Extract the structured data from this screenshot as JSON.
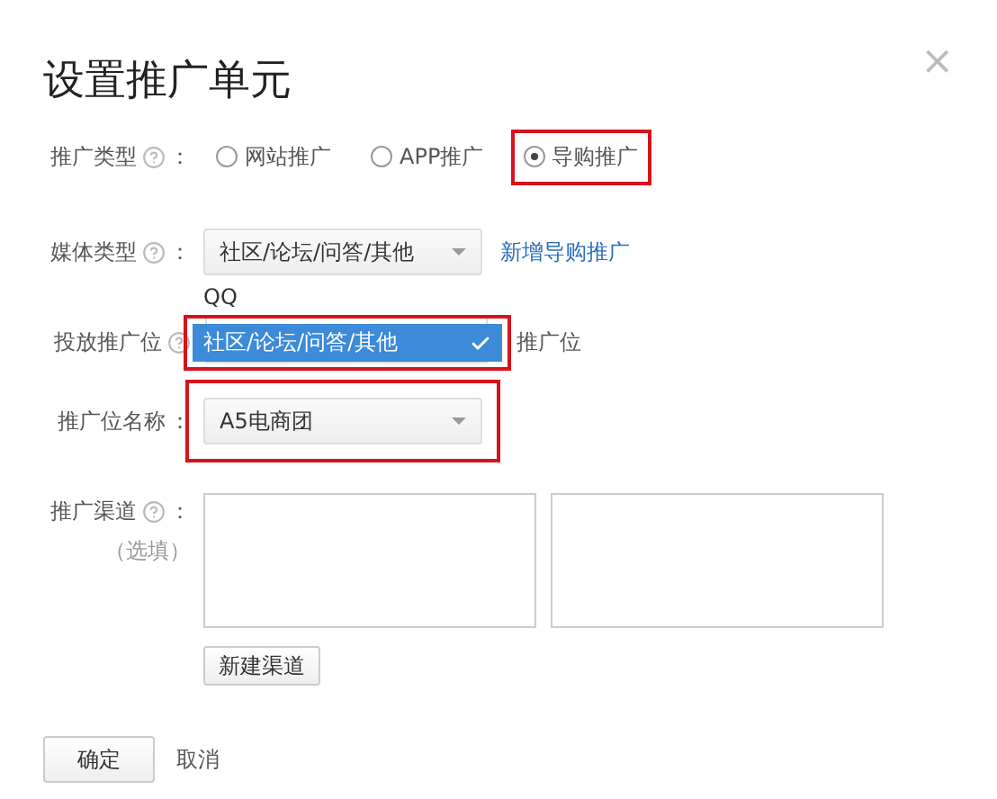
{
  "dialog": {
    "title": "设置推广单元",
    "close": "×"
  },
  "promo_type": {
    "label": "推广类型",
    "help": true,
    "colon": "：",
    "options": [
      {
        "label": "网站推广",
        "selected": false,
        "highlighted": false
      },
      {
        "label": "APP推广",
        "selected": false,
        "highlighted": false
      },
      {
        "label": "导购推广",
        "selected": true,
        "highlighted": true
      }
    ]
  },
  "media_type": {
    "label": "媒体类型",
    "help": true,
    "colon": "：",
    "value": "社区/论坛/问答/其他",
    "link": "新增导购推广",
    "options": [
      {
        "label": "QQ",
        "selected": false,
        "highlighted": false
      },
      {
        "label": "社区/论坛/问答/其他",
        "selected": true,
        "highlighted": true
      }
    ]
  },
  "placement": {
    "label": "投放推广位",
    "help": true,
    "partial_text": "推广位"
  },
  "placement_name": {
    "label": "推广位名称",
    "colon": "：",
    "value": "A5电商团",
    "highlighted": true
  },
  "channels": {
    "label": "推广渠道",
    "help": true,
    "colon": "：",
    "note": "（选填）",
    "add_button": "新建渠道"
  },
  "buttons": {
    "confirm": "确定",
    "cancel": "取消"
  }
}
